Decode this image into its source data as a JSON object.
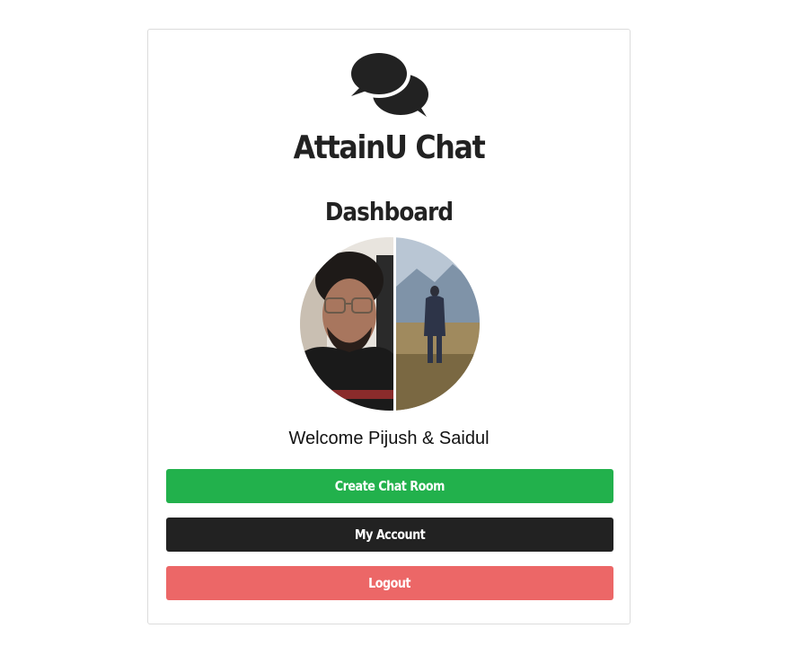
{
  "app": {
    "title": "AttainU Chat",
    "logo_icon": "chat-bubbles-icon"
  },
  "page": {
    "title": "Dashboard"
  },
  "user": {
    "avatar_icon": "user-avatar-image",
    "welcome_text": "Welcome Pijush & Saidul"
  },
  "actions": {
    "create_room_label": "Create Chat Room",
    "my_account_label": "My Account",
    "logout_label": "Logout"
  },
  "colors": {
    "create": "#22b14c",
    "account": "#222222",
    "logout": "#ec6767",
    "text": "#222222"
  }
}
